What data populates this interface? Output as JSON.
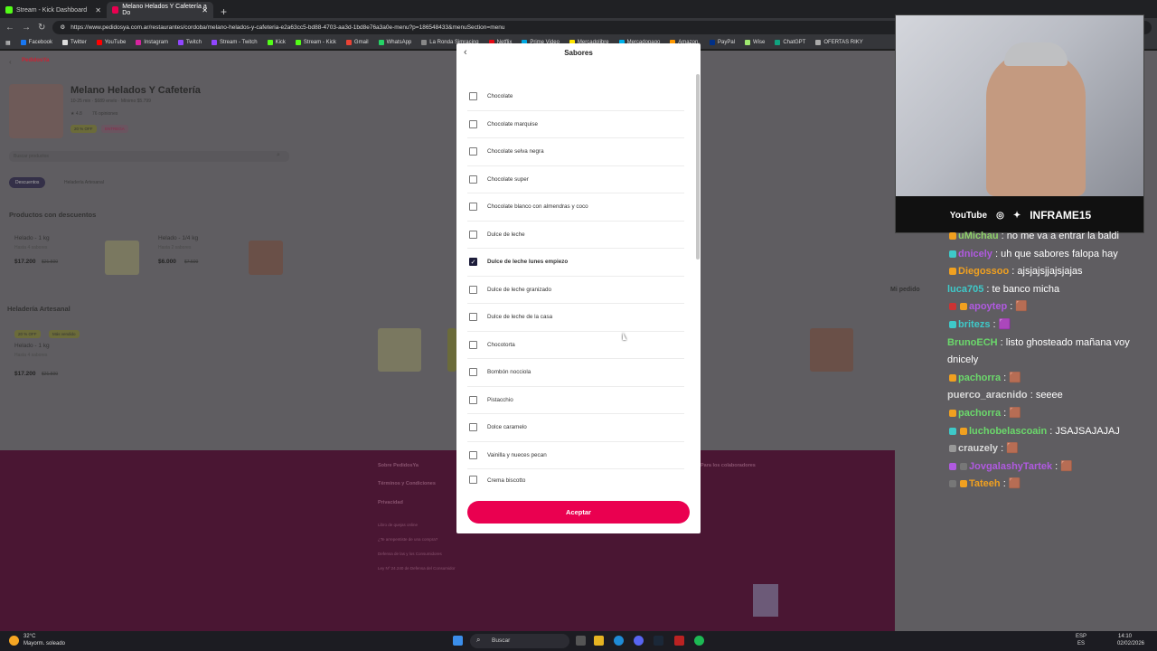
{
  "browser": {
    "tabs": [
      {
        "title": "Stream - Kick Dashboard",
        "active": false
      },
      {
        "title": "Melano Helados Y Cafetería a Do",
        "active": true
      }
    ],
    "url": "https://www.pedidosya.com.ar/restaurantes/cordoba/melano-helados-y-cafeteria-e2a63cc5-bd88-4703-aa3d-1bd8e76a3a0e-menu?p=186548433&menuSection=menu",
    "bookmarks": [
      "Facebook",
      "Twitter",
      "YouTube",
      "Instagram",
      "Twitch",
      "Stream - Twitch",
      "Kick",
      "Stream - Kick",
      "Gmail",
      "WhatsApp",
      "La Ronda Simracing",
      "Netflix",
      "Prime Video",
      "Mercadolibre",
      "Mercadopago",
      "Amazon.",
      "PayPal",
      "Wise",
      "ChatGPT",
      "OFERTAS RIKY"
    ]
  },
  "store": {
    "logo_text": "PedidosYa",
    "name": "Melano Helados Y Cafetería",
    "delivery_info": "10-25 min · $689 envío · Mínimo $5.799",
    "rating": "★ 4.8",
    "reviews": "76 opiniones",
    "badge_discount": "20 % OFF",
    "badge_delivery": "ENTREGA",
    "search_placeholder": "Buscar productos",
    "categories": [
      "Descuentos",
      "Heladería Artesanal"
    ],
    "section_discounts": "Productos con descuentos",
    "products_discount": [
      {
        "name": "Helado - 1 kg",
        "desc": "Hasta 4 sabores",
        "price": "$17.200",
        "old": "$21.500"
      },
      {
        "name": "Helado - 1/4 kg",
        "desc": "Hasta 2 sabores",
        "price": "$6.000",
        "old": "$7.500"
      }
    ],
    "section_artisan": "Heladería Artesanal",
    "artisan_tags": [
      "20 % OFF",
      "Más vendido"
    ],
    "artisan_product": {
      "name": "Helado - 1 kg",
      "desc": "Hasta 4 sabores",
      "price": "$17.200",
      "old": "$21.500"
    },
    "my_order": "Mi pedido",
    "footer_links": [
      "Sobre PedidosYa",
      "Términos y Condiciones",
      "Privacidad",
      "Libro de quejas online",
      "¿Te arrepentiste de una compra?",
      "Defensa de las y los Consumidores",
      "Ley Nº 24.240 de Defensa del Consumidor",
      "Para los colaboradores"
    ]
  },
  "modal": {
    "title": "Sabores",
    "flavors": [
      {
        "label": "Chocolate",
        "checked": false
      },
      {
        "label": "Chocolate marquise",
        "checked": false
      },
      {
        "label": "Chocolate selva negra",
        "checked": false
      },
      {
        "label": "Chocolate super",
        "checked": false
      },
      {
        "label": "Chocolate blanco con almendras y coco",
        "checked": false
      },
      {
        "label": "Dulce de leche",
        "checked": false
      },
      {
        "label": "Dulce de leche lunes empiezo",
        "checked": true
      },
      {
        "label": "Dulce de leche granizado",
        "checked": false
      },
      {
        "label": "Dulce de leche de la casa",
        "checked": false
      },
      {
        "label": "Chocotorta",
        "checked": false
      },
      {
        "label": "Bombón nocciola",
        "checked": false
      },
      {
        "label": "Pistacchio",
        "checked": false
      },
      {
        "label": "Dolce caramelo",
        "checked": false
      },
      {
        "label": "Vainilla y nueces pecan",
        "checked": false
      },
      {
        "label": "Crema biscotto",
        "checked": false
      }
    ],
    "accept_label": "Aceptar"
  },
  "webcam": {
    "socials": "YouTube",
    "handle": "INFRAME15"
  },
  "chat": [
    {
      "user": "uMichau",
      "color": "#8fd16a",
      "msg": "no me va a entrar la baldi"
    },
    {
      "user": "dnicely",
      "color": "#b05ae0",
      "msg": "uh que sabores falopa hay"
    },
    {
      "user": "Diegossoo",
      "color": "#f0a020",
      "msg": "ajsjajsjjajsjajas"
    },
    {
      "user": "luca705",
      "color": "#3ec9c9",
      "msg": "te banco micha"
    },
    {
      "user": "apoytep",
      "color": "#b05ae0",
      "msg": "🟫"
    },
    {
      "user": "britezs",
      "color": "#3ec9c9",
      "msg": "🟪"
    },
    {
      "user": "BrunoECH",
      "color": "#6bd86b",
      "msg": "listo ghosteado mañana voy dnicely"
    },
    {
      "user": "pachorra",
      "color": "#6bd86b",
      "msg": "🟫"
    },
    {
      "user": "puerco_aracnido",
      "color": "#d8d8d8",
      "msg": "seeee"
    },
    {
      "user": "pachorra",
      "color": "#6bd86b",
      "msg": "🟫"
    },
    {
      "user": "luchobelascoain",
      "color": "#6bd86b",
      "msg": "JSAJSAJAJAJ"
    },
    {
      "user": "crauzely",
      "color": "#d8d8d8",
      "msg": "🟫"
    },
    {
      "user": "JovgalashyTartek",
      "color": "#b05ae0",
      "msg": "🟫"
    },
    {
      "user": "Tateeh",
      "color": "#f0a020",
      "msg": "🟫"
    }
  ],
  "taskbar": {
    "weather_temp": "32°C",
    "weather_desc": "Mayorm. soleado",
    "search": "Buscar",
    "lang": "ESP",
    "lang2": "ES",
    "time": "14:10",
    "date": "02/02/2026"
  }
}
